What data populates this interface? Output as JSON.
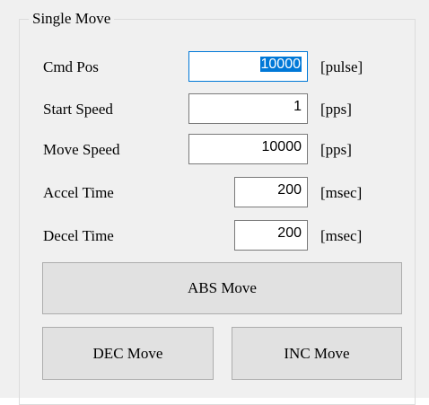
{
  "group": {
    "title": "Single Move"
  },
  "fields": [
    {
      "label": "Cmd Pos",
      "value": "10000",
      "unit": "[pulse]"
    },
    {
      "label": "Start Speed",
      "value": "1",
      "unit": "[pps]"
    },
    {
      "label": "Move Speed",
      "value": "10000",
      "unit": "[pps]"
    },
    {
      "label": "Accel Time",
      "value": "200",
      "unit": "[msec]"
    },
    {
      "label": "Decel Time",
      "value": "200",
      "unit": "[msec]"
    }
  ],
  "buttons": {
    "abs_move": "ABS Move",
    "dec_move": "DEC Move",
    "inc_move": "INC Move"
  },
  "colors": {
    "focus_accent": "#0078d7",
    "panel_background": "#f0f0f0",
    "button_face": "#e1e1e1"
  }
}
